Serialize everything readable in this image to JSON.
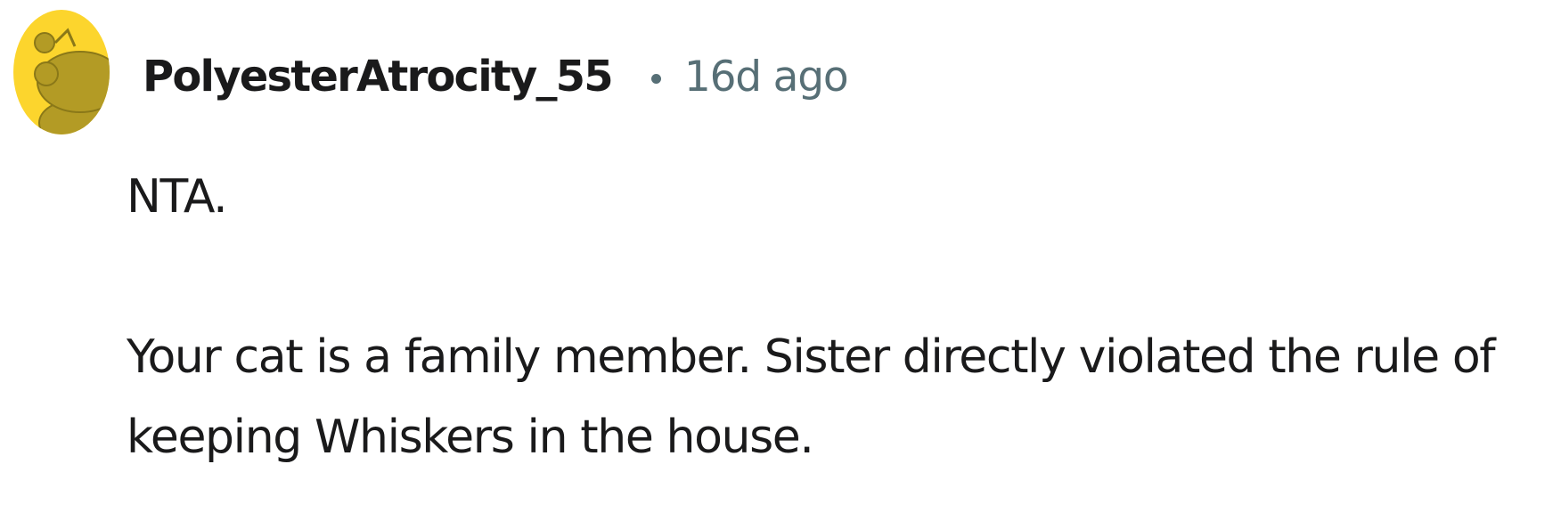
{
  "comment": {
    "author": "PolyesterAtrocity_55",
    "separator": "•",
    "timestamp": "16d ago",
    "avatar": {
      "icon": "snoo-avatar-icon",
      "background_color": "#FCD52D",
      "figure_color": "#B39B25"
    },
    "paragraphs": [
      "NTA.",
      "Your cat is a family member. Sister directly violated the rule of keeping Whiskers in the house."
    ]
  },
  "colors": {
    "text": "#1A1A1B",
    "meta": "#576F76",
    "background": "#FFFFFF"
  }
}
